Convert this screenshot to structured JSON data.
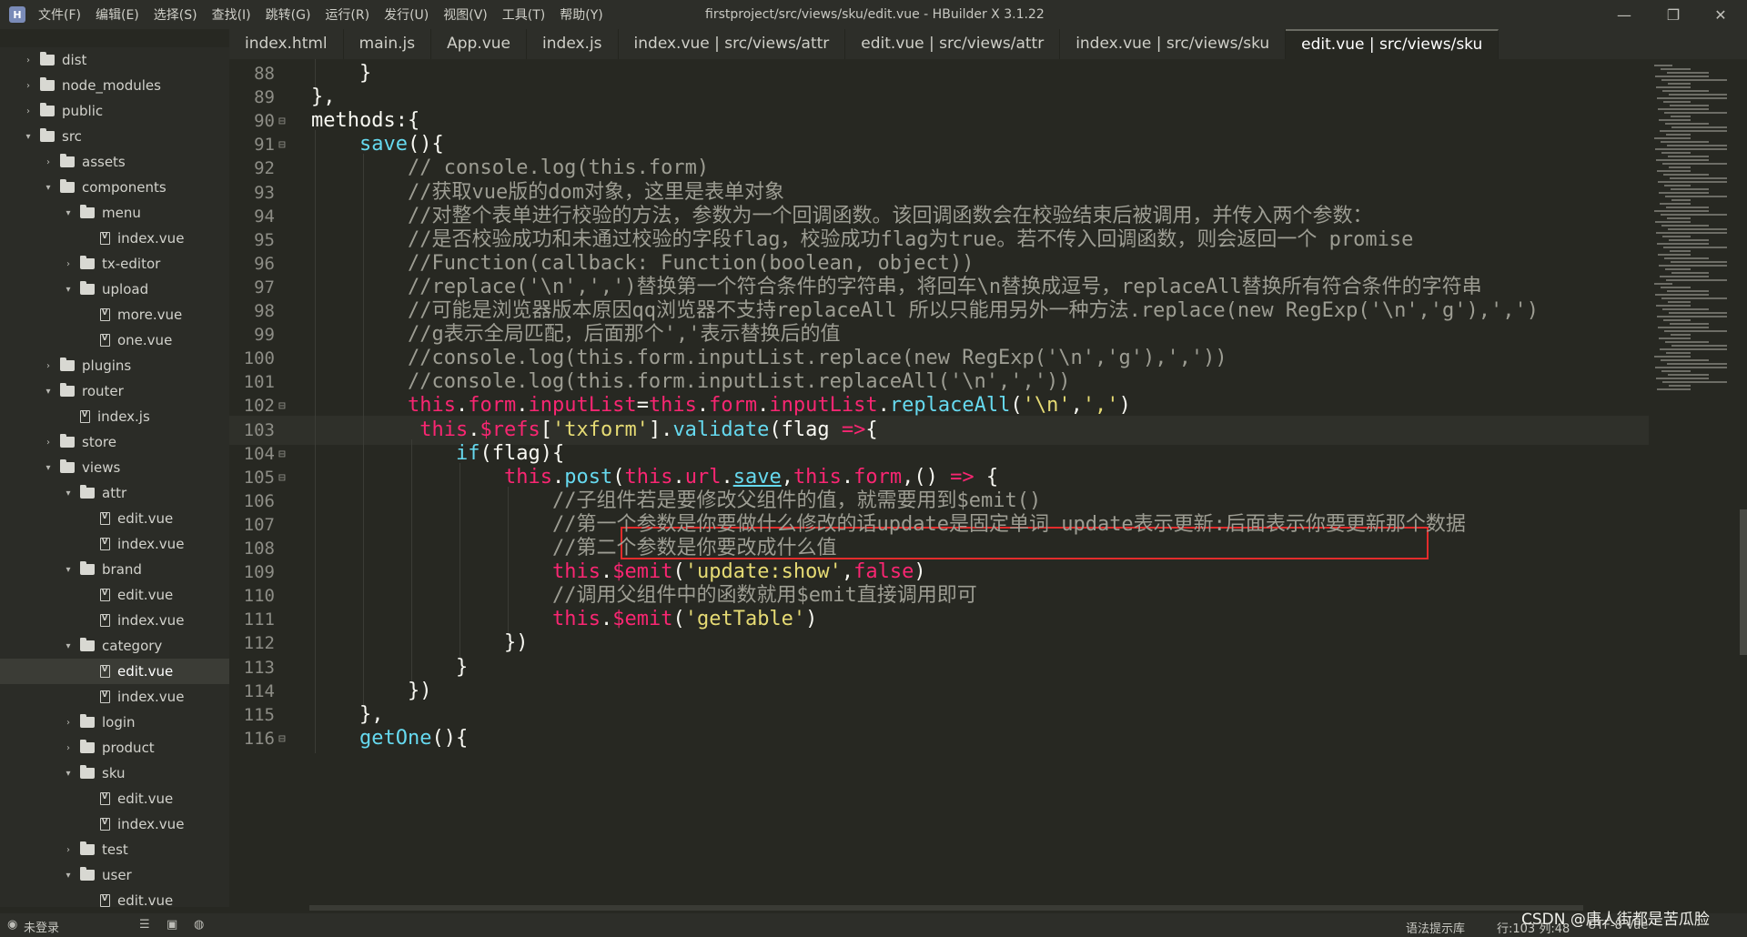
{
  "window": {
    "title": "firstproject/src/views/sku/edit.vue - HBuilder X 3.1.22",
    "logo": "H",
    "controls": {
      "minimize": "—",
      "maximize": "❐",
      "close": "✕"
    }
  },
  "menu": [
    "文件(F)",
    "编辑(E)",
    "选择(S)",
    "查找(I)",
    "跳转(G)",
    "运行(R)",
    "发行(U)",
    "视图(V)",
    "工具(T)",
    "帮助(Y)"
  ],
  "tabs": [
    {
      "label": "index.html"
    },
    {
      "label": "main.js"
    },
    {
      "label": "App.vue"
    },
    {
      "label": "index.js"
    },
    {
      "label": "index.vue | src/views/attr"
    },
    {
      "label": "edit.vue | src/views/attr"
    },
    {
      "label": "index.vue | src/views/sku"
    },
    {
      "label": "edit.vue | src/views/sku",
      "active": true
    }
  ],
  "tree": [
    {
      "name": "dist",
      "type": "folder",
      "depth": 0,
      "state": "closed"
    },
    {
      "name": "node_modules",
      "type": "folder",
      "depth": 0,
      "state": "closed"
    },
    {
      "name": "public",
      "type": "folder",
      "depth": 0,
      "state": "closed"
    },
    {
      "name": "src",
      "type": "folder",
      "depth": 0,
      "state": "open"
    },
    {
      "name": "assets",
      "type": "folder",
      "depth": 1,
      "state": "closed"
    },
    {
      "name": "components",
      "type": "folder",
      "depth": 1,
      "state": "open"
    },
    {
      "name": "menu",
      "type": "folder",
      "depth": 2,
      "state": "open"
    },
    {
      "name": "index.vue",
      "type": "file",
      "depth": 3
    },
    {
      "name": "tx-editor",
      "type": "folder",
      "depth": 2,
      "state": "closed"
    },
    {
      "name": "upload",
      "type": "folder",
      "depth": 2,
      "state": "open"
    },
    {
      "name": "more.vue",
      "type": "file",
      "depth": 3
    },
    {
      "name": "one.vue",
      "type": "file",
      "depth": 3
    },
    {
      "name": "plugins",
      "type": "folder",
      "depth": 1,
      "state": "closed"
    },
    {
      "name": "router",
      "type": "folder",
      "depth": 1,
      "state": "open"
    },
    {
      "name": "index.js",
      "type": "file",
      "depth": 2
    },
    {
      "name": "store",
      "type": "folder",
      "depth": 1,
      "state": "closed"
    },
    {
      "name": "views",
      "type": "folder",
      "depth": 1,
      "state": "open"
    },
    {
      "name": "attr",
      "type": "folder",
      "depth": 2,
      "state": "open"
    },
    {
      "name": "edit.vue",
      "type": "file",
      "depth": 3
    },
    {
      "name": "index.vue",
      "type": "file",
      "depth": 3
    },
    {
      "name": "brand",
      "type": "folder",
      "depth": 2,
      "state": "open"
    },
    {
      "name": "edit.vue",
      "type": "file",
      "depth": 3
    },
    {
      "name": "index.vue",
      "type": "file",
      "depth": 3
    },
    {
      "name": "category",
      "type": "folder",
      "depth": 2,
      "state": "open"
    },
    {
      "name": "edit.vue",
      "type": "file",
      "depth": 3,
      "selected": true
    },
    {
      "name": "index.vue",
      "type": "file",
      "depth": 3
    },
    {
      "name": "login",
      "type": "folder",
      "depth": 2,
      "state": "closed"
    },
    {
      "name": "product",
      "type": "folder",
      "depth": 2,
      "state": "closed"
    },
    {
      "name": "sku",
      "type": "folder",
      "depth": 2,
      "state": "open"
    },
    {
      "name": "edit.vue",
      "type": "file",
      "depth": 3
    },
    {
      "name": "index.vue",
      "type": "file",
      "depth": 3
    },
    {
      "name": "test",
      "type": "folder",
      "depth": 2,
      "state": "closed"
    },
    {
      "name": "user",
      "type": "folder",
      "depth": 2,
      "state": "open"
    },
    {
      "name": "edit.vue",
      "type": "file",
      "depth": 3
    }
  ],
  "code_lines": [
    {
      "n": "88",
      "indent": 4,
      "tokens": [
        [
          "}",
          "pl"
        ]
      ]
    },
    {
      "n": "89",
      "indent": 0,
      "tokens": [
        [
          "},",
          "pl"
        ]
      ]
    },
    {
      "n": "90",
      "indent": 0,
      "fold": true,
      "tokens": [
        [
          "methods:{",
          "pl"
        ]
      ]
    },
    {
      "n": "91",
      "indent": 4,
      "fold": true,
      "tokens": [
        [
          "save",
          "fn"
        ],
        [
          "(){",
          "pl"
        ]
      ]
    },
    {
      "n": "92",
      "indent": 8,
      "tokens": [
        [
          "// console.log(this.form)",
          "cm"
        ]
      ]
    },
    {
      "n": "93",
      "indent": 8,
      "tokens": [
        [
          "//获取vue版的dom对象，这里是表单对象",
          "cm"
        ]
      ]
    },
    {
      "n": "94",
      "indent": 8,
      "tokens": [
        [
          "//对整个表单进行校验的方法，参数为一个回调函数。该回调函数会在校验结束后被调用，并传入两个参数：",
          "cm"
        ]
      ]
    },
    {
      "n": "95",
      "indent": 8,
      "tokens": [
        [
          "//是否校验成功和未通过校验的字段flag，校验成功flag为true。若不传入回调函数，则会返回一个 promise",
          "cm"
        ]
      ]
    },
    {
      "n": "96",
      "indent": 8,
      "tokens": [
        [
          "//Function(callback: Function(boolean, object))",
          "cm"
        ]
      ]
    },
    {
      "n": "97",
      "indent": 8,
      "tokens": [
        [
          "//replace('\\n',',')替换第一个符合条件的字符串，将回车\\n替换成逗号，replaceAll替换所有符合条件的字符串",
          "cm"
        ]
      ]
    },
    {
      "n": "98",
      "indent": 8,
      "tokens": [
        [
          "//可能是浏览器版本原因qq浏览器不支持replaceAll 所以只能用另外一种方法.replace(new RegExp('\\n','g'),',')",
          "cm"
        ]
      ]
    },
    {
      "n": "99",
      "indent": 8,
      "tokens": [
        [
          "//g表示全局匹配，后面那个','表示替换后的值",
          "cm"
        ]
      ]
    },
    {
      "n": "100",
      "indent": 8,
      "tokens": [
        [
          "//console.log(this.form.inputList.replace(new RegExp('\\n','g'),','))",
          "cm"
        ]
      ]
    },
    {
      "n": "101",
      "indent": 8,
      "tokens": [
        [
          "//console.log(this.form.inputList.replaceAll('\\n',','))",
          "cm"
        ]
      ]
    },
    {
      "n": "102",
      "indent": 8,
      "fold": true,
      "tokens": [
        [
          "this",
          "kw"
        ],
        [
          ".",
          "pl"
        ],
        [
          "form",
          "kw"
        ],
        [
          ".",
          "pl"
        ],
        [
          "inputList",
          "kw"
        ],
        [
          "=",
          "pl"
        ],
        [
          "this",
          "kw"
        ],
        [
          ".",
          "pl"
        ],
        [
          "form",
          "kw"
        ],
        [
          ".",
          "pl"
        ],
        [
          "inputList",
          "kw"
        ],
        [
          ".",
          "pl"
        ],
        [
          "replaceAll",
          "fn"
        ],
        [
          "(",
          "pl"
        ],
        [
          "'\\n'",
          "str"
        ],
        [
          ",",
          "pl"
        ],
        [
          "','",
          "str"
        ],
        [
          ")",
          "pl"
        ]
      ]
    },
    {
      "n": "103",
      "indent": 9,
      "current": true,
      "tokens": [
        [
          "this",
          "kw"
        ],
        [
          ".",
          "pl"
        ],
        [
          "$refs",
          "kw"
        ],
        [
          "[",
          "pl"
        ],
        [
          "'txform'",
          "str"
        ],
        [
          "].",
          "pl"
        ],
        [
          "validate",
          "fn"
        ],
        [
          "(flag ",
          "pl"
        ],
        [
          "=>",
          "kw"
        ],
        [
          "{",
          "pl"
        ]
      ]
    },
    {
      "n": "104",
      "indent": 12,
      "fold": true,
      "tokens": [
        [
          "if",
          "fn"
        ],
        [
          "(flag){",
          "pl"
        ]
      ]
    },
    {
      "n": "105",
      "indent": 16,
      "fold": true,
      "tokens": [
        [
          "this",
          "kw"
        ],
        [
          ".",
          "pl"
        ],
        [
          "post",
          "fn"
        ],
        [
          "(",
          "pl"
        ],
        [
          "this",
          "kw"
        ],
        [
          ".",
          "pl"
        ],
        [
          "url",
          "kw"
        ],
        [
          ".",
          "pl"
        ],
        [
          "save",
          "fn ul"
        ],
        [
          ",",
          "pl"
        ],
        [
          "this",
          "kw"
        ],
        [
          ".",
          "pl"
        ],
        [
          "form",
          "kw"
        ],
        [
          ",() ",
          "pl"
        ],
        [
          "=>",
          "kw"
        ],
        [
          " {",
          "pl"
        ]
      ]
    },
    {
      "n": "106",
      "indent": 20,
      "tokens": [
        [
          "//子组件若是要修改父组件的值，就需要用到$emit()",
          "cm"
        ]
      ]
    },
    {
      "n": "107",
      "indent": 20,
      "tokens": [
        [
          "//第一个参数是你要做什么修改的话update是固定单词 update表示更新:后面表示你要更新那个数据",
          "cm"
        ]
      ]
    },
    {
      "n": "108",
      "indent": 20,
      "tokens": [
        [
          "//第二个参数是你要改成什么值",
          "cm"
        ]
      ]
    },
    {
      "n": "109",
      "indent": 20,
      "tokens": [
        [
          "this",
          "kw"
        ],
        [
          ".",
          "pl"
        ],
        [
          "$emit",
          "kw"
        ],
        [
          "(",
          "pl"
        ],
        [
          "'update:show'",
          "str"
        ],
        [
          ",",
          "pl"
        ],
        [
          "false",
          "kw"
        ],
        [
          ")",
          "pl"
        ]
      ]
    },
    {
      "n": "110",
      "indent": 20,
      "tokens": [
        [
          "//调用父组件中的函数就用$emit直接调用即可",
          "cm"
        ]
      ]
    },
    {
      "n": "111",
      "indent": 20,
      "tokens": [
        [
          "this",
          "kw"
        ],
        [
          ".",
          "pl"
        ],
        [
          "$emit",
          "kw"
        ],
        [
          "(",
          "pl"
        ],
        [
          "'getTable'",
          "str"
        ],
        [
          ")",
          "pl"
        ]
      ]
    },
    {
      "n": "112",
      "indent": 16,
      "tokens": [
        [
          "})",
          "pl"
        ]
      ]
    },
    {
      "n": "113",
      "indent": 12,
      "tokens": [
        [
          "}",
          "pl"
        ]
      ]
    },
    {
      "n": "114",
      "indent": 8,
      "tokens": [
        [
          "})",
          "pl"
        ]
      ]
    },
    {
      "n": "115",
      "indent": 4,
      "tokens": [
        [
          "},",
          "pl"
        ]
      ]
    },
    {
      "n": "116",
      "indent": 4,
      "fold": true,
      "tokens": [
        [
          "getOne",
          "fn"
        ],
        [
          "(){",
          "pl"
        ]
      ]
    }
  ],
  "status": {
    "user": "未登录",
    "syntax_lib": "语法提示库",
    "position": "行:103  列:48",
    "encoding": "UTF-8  Vue"
  },
  "watermark": "CSDN @唐人街都是苦瓜脸",
  "colors": {
    "keyword": "#f92672",
    "function": "#66d9ef",
    "string": "#e6db74",
    "comment": "#9d9d93",
    "highlight_box": "#e32c2c"
  }
}
